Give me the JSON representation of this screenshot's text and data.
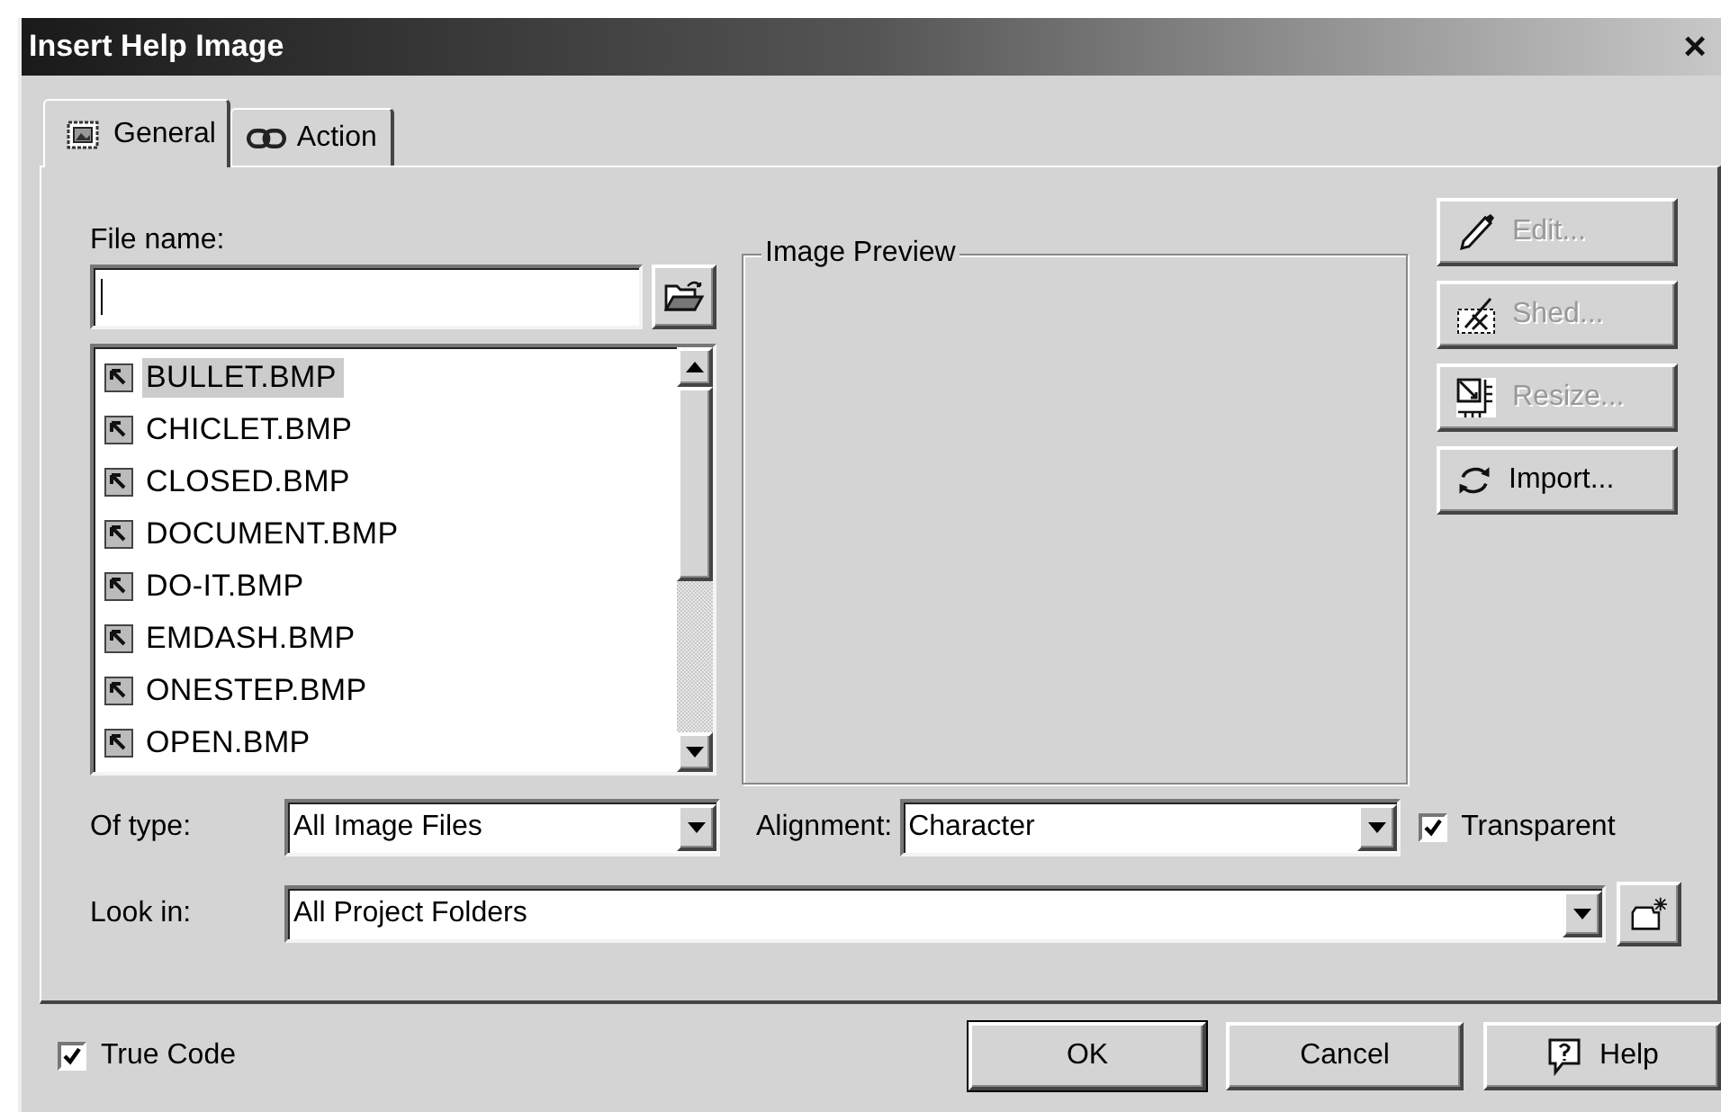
{
  "window": {
    "title": "Insert Help Image",
    "close": "×"
  },
  "tabs": [
    {
      "label": "General",
      "selected": true,
      "kind": "image"
    },
    {
      "label": "Action",
      "selected": false,
      "kind": "link"
    }
  ],
  "file_name": {
    "label": "File name:"
  },
  "files": [
    {
      "name": "BULLET.BMP",
      "selected": true
    },
    {
      "name": "CHICLET.BMP",
      "selected": false
    },
    {
      "name": "CLOSED.BMP",
      "selected": false
    },
    {
      "name": "DOCUMENT.BMP",
      "selected": false
    },
    {
      "name": "DO-IT.BMP",
      "selected": false
    },
    {
      "name": "EMDASH.BMP",
      "selected": false
    },
    {
      "name": "ONESTEP.BMP",
      "selected": false
    },
    {
      "name": "OPEN.BMP",
      "selected": false
    }
  ],
  "preview": {
    "title": "Image Preview"
  },
  "side_buttons": [
    {
      "label": "Edit...",
      "disabled": true,
      "kind": "pencil"
    },
    {
      "label": "Shed...",
      "disabled": true,
      "kind": "shed"
    },
    {
      "label": "Resize...",
      "disabled": true,
      "kind": "resize"
    },
    {
      "label": "Import...",
      "disabled": false,
      "kind": "import"
    }
  ],
  "of_type": {
    "label": "Of type:",
    "value": "All Image Files"
  },
  "alignment": {
    "label": "Alignment:",
    "value": "Character"
  },
  "transparent": {
    "label": "Transparent",
    "checked": true
  },
  "look_in": {
    "label": "Look in:",
    "value": "All Project Folders"
  },
  "true_code": {
    "label": "True Code",
    "checked": true
  },
  "buttons": [
    {
      "label": "OK",
      "kind": "default"
    },
    {
      "label": "Cancel",
      "kind": "plain"
    },
    {
      "label": "Help",
      "kind": "help"
    }
  ]
}
